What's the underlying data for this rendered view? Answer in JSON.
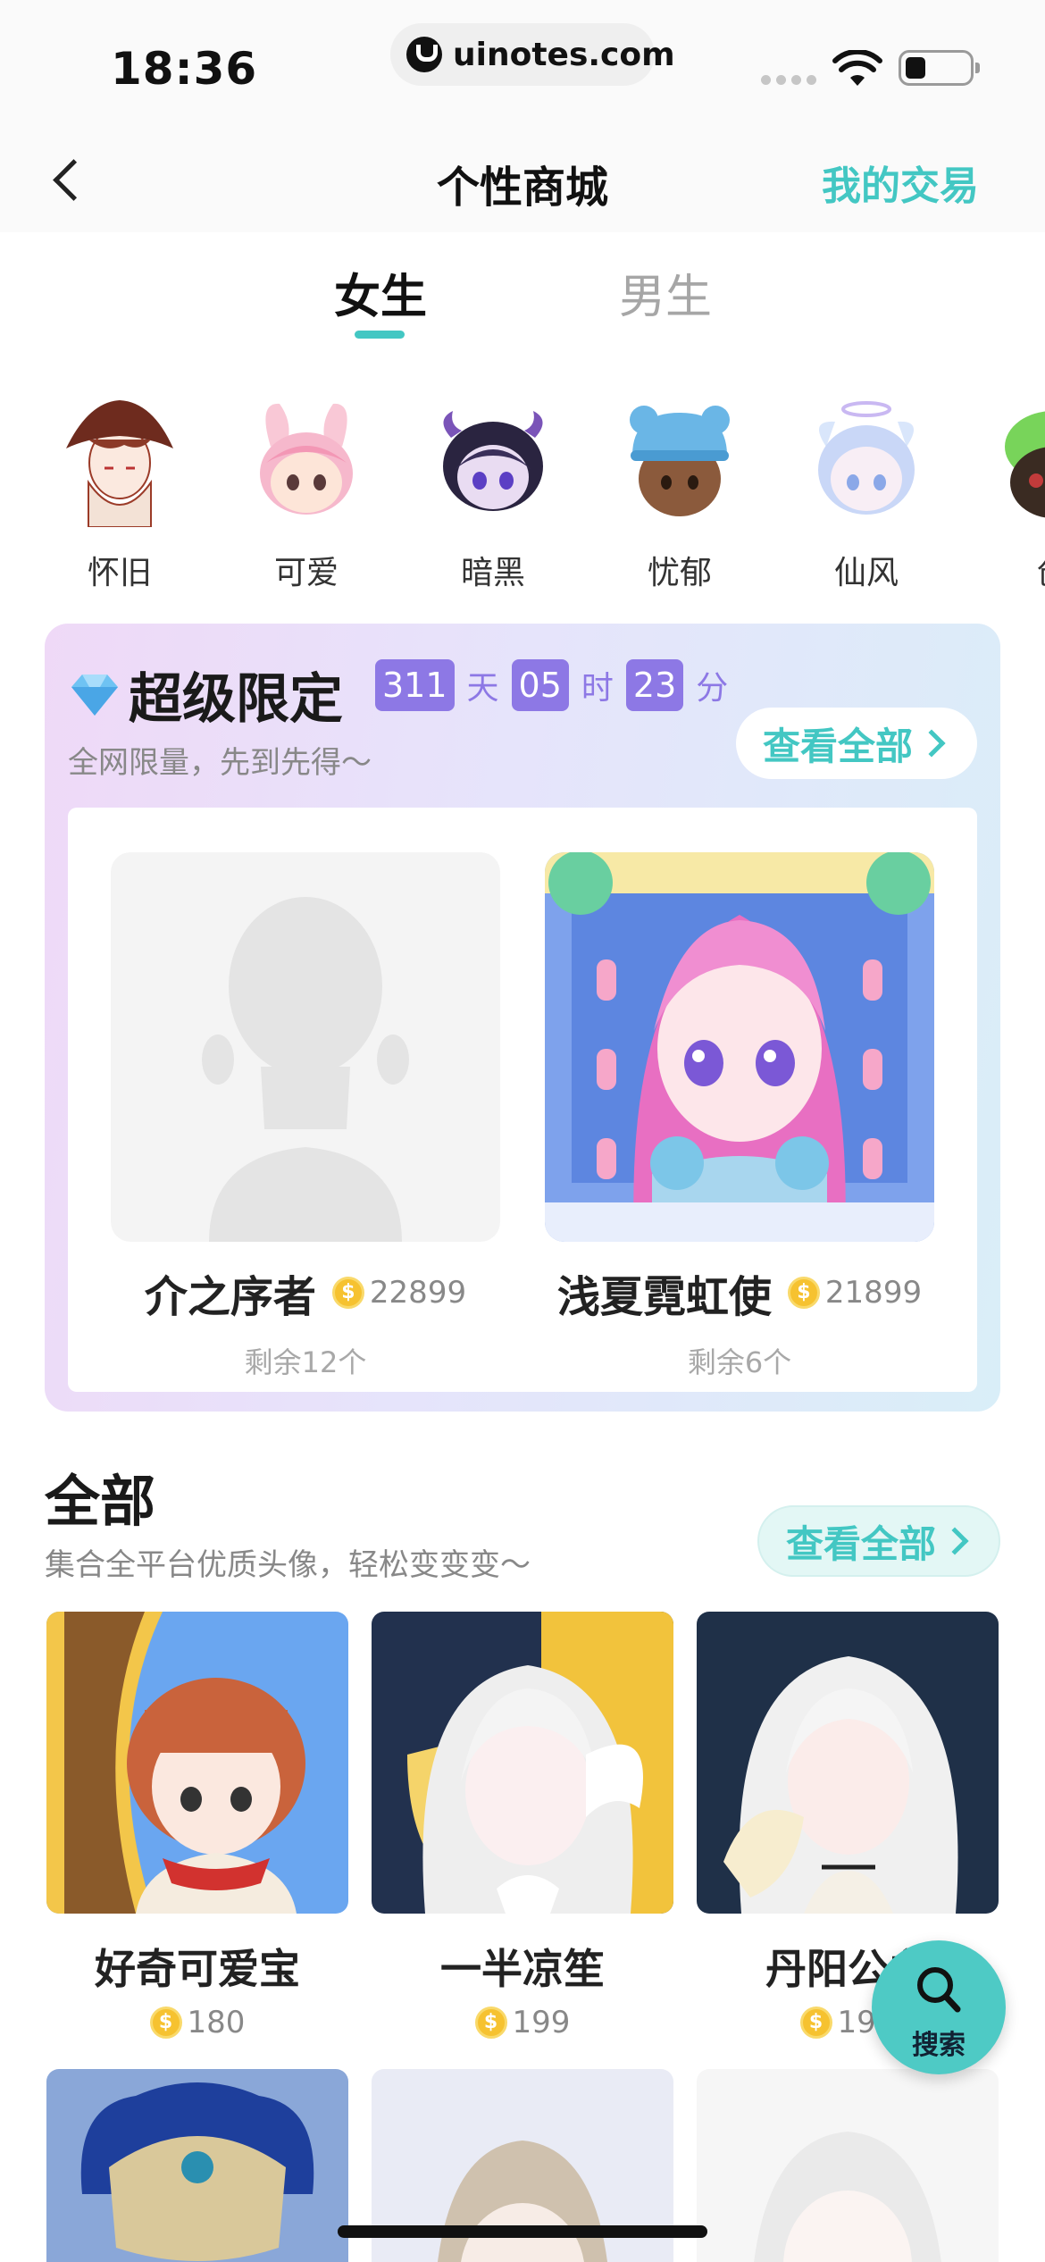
{
  "status_bar": {
    "time": "18:36",
    "url": "uinotes.com"
  },
  "nav": {
    "title": "个性商城",
    "my_trade": "我的交易"
  },
  "gender_tabs": {
    "female": "女生",
    "male": "男生",
    "selected": "女生"
  },
  "styles": [
    {
      "label": "怀旧"
    },
    {
      "label": "可爱"
    },
    {
      "label": "暗黑"
    },
    {
      "label": "忧郁"
    },
    {
      "label": "仙风"
    },
    {
      "label": "创"
    }
  ],
  "limited": {
    "title": "超级限定",
    "countdown": {
      "days": "311",
      "days_unit": "天",
      "hours": "05",
      "hours_unit": "时",
      "minutes": "23",
      "minutes_unit": "分"
    },
    "subtitle": "全网限量，先到先得～",
    "view_all": "查看全部",
    "products": [
      {
        "name": "介之序者",
        "price": "22899",
        "stock": "剩余12个"
      },
      {
        "name": "浅夏霓虹使",
        "price": "21899",
        "stock": "剩余6个"
      }
    ]
  },
  "all_section": {
    "title": "全部",
    "subtitle": "集合全平台优质头像，轻松变变变～",
    "view_all": "查看全部",
    "items": [
      {
        "name": "好奇可爱宝",
        "price": "180"
      },
      {
        "name": "一半凉笙",
        "price": "199"
      },
      {
        "name": "丹阳公主",
        "price": "199"
      }
    ]
  },
  "search_fab": {
    "label": "搜索"
  },
  "colors": {
    "accent": "#43c7c3",
    "countdown": "#8d78e5",
    "coin": "#f6c230"
  }
}
